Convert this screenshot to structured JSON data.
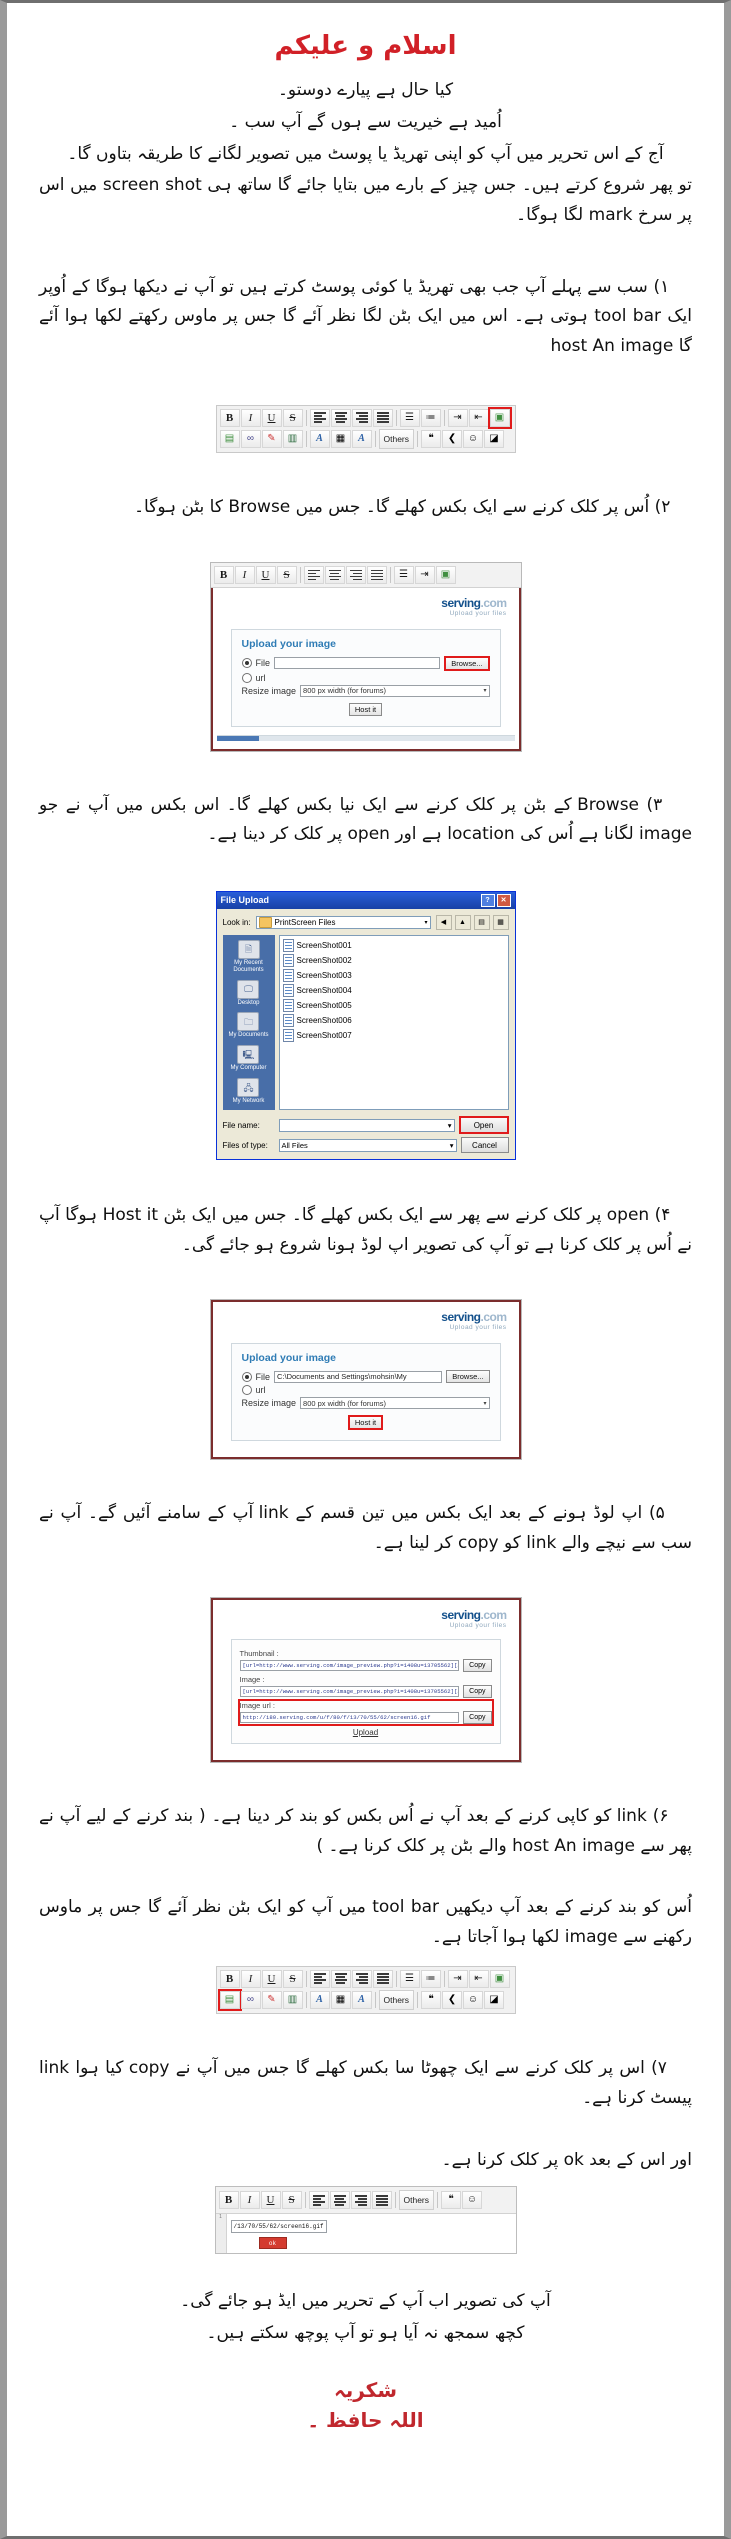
{
  "document": {
    "heading": "اسلام و علیکم",
    "intro_lines": [
      "کیا حال ہے پیارے دوستو۔",
      "اُمید ہے خیریت سے ہوں گے آپ سب ۔",
      "آج کے اس تحریر میں آپ کو اپنی تھریڈ یا پوسٹ میں تصویر لگانے کا طریقہ بتاوں گا۔",
      "تو پھر شروع کرتے ہیں۔ جس چیز کے بارے میں بتایا جائے گا ساتھ ہی screen shot میں اس پر سرخ mark لگا ہوگا۔"
    ],
    "steps": [
      {
        "number": "۱",
        "text": "سب سے پہلے آپ جب بھی تھریڈ یا کوئی پوسٹ کرتے ہیں تو آپ نے دیکھا ہوگا کے اُوپر ایک tool bar ہوتی ہے۔ اس میں ایک بٹن لگا نظر آئے گا جس پر ماوس رکھتے لکھا ہوا آئے گا host An image"
      },
      {
        "number": "۲",
        "text": "اُس پر کلک کرنے سے ایک بکس کھلے گا۔ جس میں Browse کا بٹن ہوگا۔"
      },
      {
        "number": "۳",
        "text": "Browse کے بٹن پر کلک کرنے سے ایک نیا بکس کھلے گا۔ اس بکس میں آپ نے جو image لگانا ہے اُس کی location ہے اور open پر کلک کر دینا ہے۔"
      },
      {
        "number": "۴",
        "text": "open پر کلک کرنے سے پھر سے ایک بکس کھلے گا۔ جس میں ایک بٹن Host it ہوگا آپ نے اُس پر کلک کرنا ہے تو آپ کی تصویر اپ لوڈ ہونا شروع ہو جائے گی۔"
      },
      {
        "number": "۵",
        "text": "اپ لوڈ ہونے کے بعد ایک بکس میں تین قسم کے link آپ کے سامنے آئیں گے۔ آپ نے سب سے نیچے والے link کو copy کر لینا ہے۔"
      },
      {
        "number": "۶",
        "text": "link کو کاپی کرنے کے بعد آپ نے اُس بکس کو بند کر دینا ہے۔ ( بند کرنے کے لیے آپ نے پھر سے host An image والے بٹن پر کلک کرنا ہے۔ )"
      },
      {
        "number": "",
        "text": "اُس کو بند کرنے کے بعد آپ دیکھیں tool bar میں آپ کو ایک بٹن نظر آئے گا جس پر ماوس رکھنے سے image لکھا ہوا آجاتا ہے۔"
      },
      {
        "number": "۷",
        "text": "اس پر کلک کرنے سے ایک چھوٹا سا بکس کھلے گا جس میں آپ نے copy کیا ہوا link پیسٹ کرنا ہے۔"
      },
      {
        "number": "",
        "text": "اور اس کے بعد ok پر کلک کرنا ہے۔"
      }
    ],
    "outro_lines": [
      "آپ کی تصویر اب آپ کے تحریر میں ایڈ ہو جائے گی۔",
      "کچھ سمجھ نہ آیا ہو تو آپ پوچھ سکتے ہیں۔"
    ],
    "closing": [
      "شکریہ",
      "اللہ حافظ ۔"
    ]
  },
  "editor_toolbar": {
    "buttons_row1": [
      "B",
      "I",
      "U",
      "S"
    ],
    "align_buttons": [
      "align-left",
      "align-center",
      "align-right",
      "align-justify"
    ],
    "buttons_row2_icons": [
      "image-icon",
      "link-icon",
      "attachment-icon",
      "list-icon",
      "font-color-icon",
      "palette-icon",
      "font-size-icon"
    ],
    "others_label": "Others",
    "highlighted_button": "host-an-image-button",
    "highlighted_button_2": "insert-image-button"
  },
  "serving_site": {
    "logo": "serving",
    "logo_suffix": ".com",
    "tagline": "Upload your files",
    "panel_title": "Upload your image",
    "file_label": "File",
    "url_label": "url",
    "resize_label": "Resize image",
    "resize_value": "800 px width (for forums)",
    "browse_label": "Browse...",
    "host_button": "Host it",
    "file_value_empty": "",
    "file_value_filled": "C:\\Documents and Settings\\mohsin\\My"
  },
  "file_upload_dialog": {
    "title": "File Upload",
    "help_btn": "?",
    "close_btn": "✕",
    "look_in_label": "Look in:",
    "look_in_value": "PrintScreen Files",
    "places": [
      {
        "label": "My Recent Documents",
        "icon": "recent-documents-icon"
      },
      {
        "label": "Desktop",
        "icon": "desktop-icon"
      },
      {
        "label": "My Documents",
        "icon": "my-documents-icon"
      },
      {
        "label": "My Computer",
        "icon": "my-computer-icon"
      },
      {
        "label": "My Network",
        "icon": "my-network-icon"
      }
    ],
    "files": [
      "ScreenShot001",
      "ScreenShot002",
      "ScreenShot003",
      "ScreenShot004",
      "ScreenShot005",
      "ScreenShot006",
      "ScreenShot007"
    ],
    "file_name_label": "File name:",
    "file_name_value": "",
    "file_type_label": "Files of type:",
    "file_type_value": "All Files",
    "open_button": "Open",
    "cancel_button": "Cancel"
  },
  "result_panel": {
    "thumbnail_label": "Thumbnail :",
    "thumbnail_value": "[url=http://www.serving.com/image_preview.php?i=1408u=13705562][img",
    "image_label": "Image :",
    "image_value": "[url=http://www.serving.com/image_preview.php?i=1408u=13705562][img",
    "image_url_label": "Image url :",
    "image_url_value": "http://i80.serving.com/u/f/80/f/13/70/55/62/screen16.gif",
    "copy_label": "Copy",
    "upload_link": "Upload"
  },
  "insert_image_dialog": {
    "url_value": "/13/70/55/62/screen16.gif",
    "ok_button": "ok",
    "line_number": "1"
  },
  "colors": {
    "heading_red": "#d12027",
    "closing_red": "#c0272d",
    "highlight_red": "#e01b1b",
    "serving_blue": "#14518c",
    "panel_title_blue": "#2f7cb5",
    "win_title_blue": "#1941a5"
  }
}
